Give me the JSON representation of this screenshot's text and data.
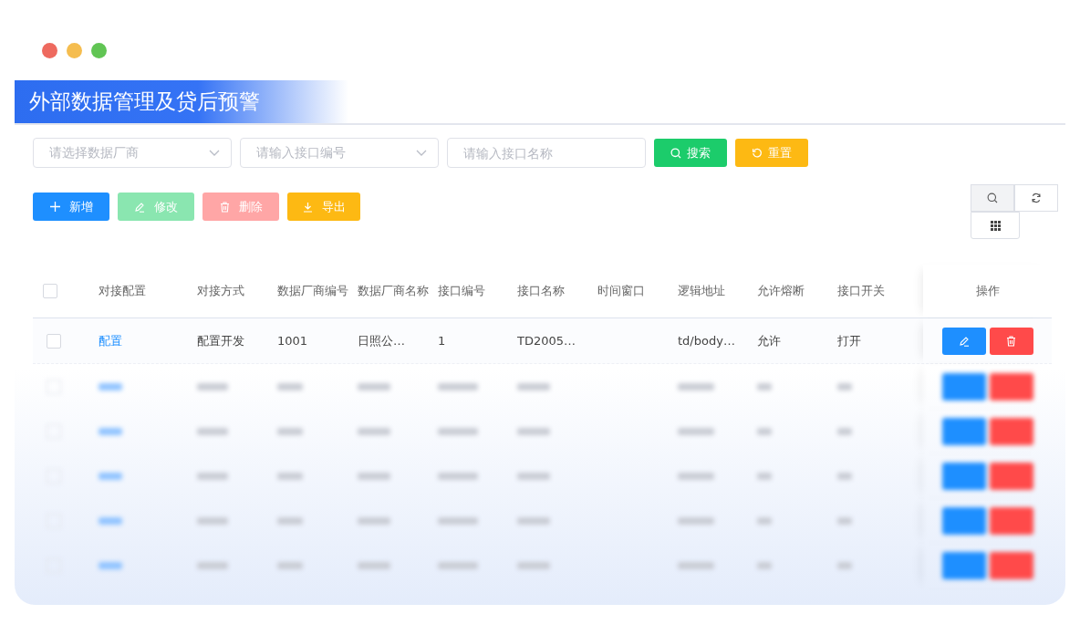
{
  "window": {
    "controls": [
      {
        "color": "#ee6a5f"
      },
      {
        "color": "#f5bd4f"
      },
      {
        "color": "#61c554"
      }
    ]
  },
  "title": "外部数据管理及贷后预警",
  "filters": [
    {
      "kind": "select",
      "placeholder": "请选择数据厂商"
    },
    {
      "kind": "select",
      "placeholder": "请输入接口编号"
    },
    {
      "kind": "input",
      "placeholder": "请输入接口名称"
    }
  ],
  "filter_buttons": [
    {
      "kind": "search",
      "label": "搜索"
    },
    {
      "kind": "reset",
      "label": "重置"
    }
  ],
  "actions": [
    {
      "kind": "add",
      "label": "新增",
      "disabled": false
    },
    {
      "kind": "edit",
      "label": "修改",
      "disabled": true
    },
    {
      "kind": "delete",
      "label": "删除",
      "disabled": true
    },
    {
      "kind": "export",
      "label": "导出",
      "disabled": false
    }
  ],
  "tools": [
    {
      "kind": "search",
      "selected": true
    },
    {
      "kind": "refresh",
      "selected": false
    },
    {
      "kind": "columns",
      "selected": false
    }
  ],
  "table": {
    "header_checked": false,
    "columns": [
      "对接配置",
      "对接方式",
      "数据厂商编号",
      "数据厂商名称",
      "接口编号",
      "接口名称",
      "时间窗口",
      "逻辑地址",
      "允许熔断",
      "接口开关"
    ],
    "action_column": "操作",
    "rows": [
      {
        "checked": false,
        "cells": [
          "配置",
          "配置开发",
          "1001",
          "日照公…",
          "1",
          "TD2005…",
          "",
          "td/body…",
          "允许",
          "打开"
        ]
      }
    ],
    "blurred_rows": [
      {
        "kind": "blurred"
      },
      {
        "kind": "blurred"
      },
      {
        "kind": "blurred"
      },
      {
        "kind": "blurred"
      },
      {
        "kind": "blurred"
      }
    ]
  }
}
